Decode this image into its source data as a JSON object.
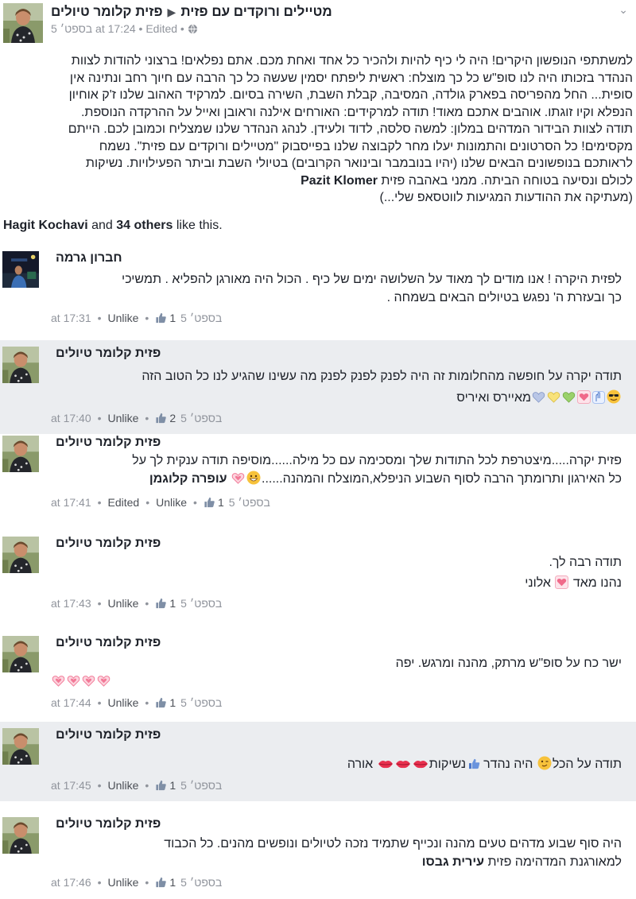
{
  "header": {
    "author": "פזית קלומר טיולים",
    "arrow": "▶",
    "group": "מטיילים ורוקדים עם פזית",
    "meta": "5 בספט׳ at 17:24 • Edited •"
  },
  "post": {
    "lines": [
      "למשתתפי הנופשון היקרים! היה לי כיף להיות ולהכיר כל אחד ואחת מכם. אתם נפלאים! ברצוני להודות לצוות",
      "הנהדר בזכותו היה לנו סופ\"ש כל כך מוצלח: ראשית ליפתח יסמין שעשה כל כך הרבה עם חיוך רחב ונתינה אין",
      "סופית... החל מהפריסה בפארק גולדה, המסיבה, קבלת השבת, השירה בסיום. למרקיד האהוב שלנו ז'ק אוחיון",
      "הנפלא וקיו זוגתו. אוהבים אתכם מאוד! תודה למרקידים: האורחים אילנה וראובן ואייל על ההרקדה הנוספת.",
      "תודה לצוות הבידור המדהים במלון: למשה סלסה, לדוד ולעידן. לנהג הנהדר שלנו שמצליח וכמובן לכם. הייתם",
      "מקסימים! כל הסרטונים והתמונות יעלו מחר לקבוצה שלנו בפייסבוק \"מטיילים ורוקדים עם פזית\". נשמח",
      "לראותכם בנופשונים הבאים שלנו (יהיו בנובמבר ובינואר הקרובים) בטיולי השבת וביתר הפעילויות. נשיקות"
    ],
    "line8_pre": "לכולם  ונסיעה בטוחה הביתה. ממני באהבה פזית ",
    "line8_name": "Pazit Klomer",
    "line9": "(מעתיקה את ההודעות המגיעות לווטסאפ שלי...)"
  },
  "likes": {
    "name": "Hagit Kochavi",
    "mid": " and ",
    "others": "34 others",
    "suffix": " like this."
  },
  "comments": [
    {
      "author": "חברון גרמה",
      "lines": [
        "לפזית היקרה ! אנו מודים לך מאוד על השלושה ימים של כיף . הכול היה מאורגן להפליא . תמשיכי",
        "כך ובעזרת ה' נפגש בטיולים הבאים בשמחה ."
      ],
      "time": "at 17:31",
      "unlike": "Unlike",
      "count": "1",
      "date": "5 בספט׳"
    },
    {
      "author": "פזית קלומר טיולים",
      "lines": [
        "תודה יקרה על חופשה מהחלומות זה היה לפנק לפנק לפנק מה עשינו שהגיע לנו כל הטוב הזה"
      ],
      "line2_text": "מאיירס ואיריס",
      "time": "at 17:40",
      "unlike": "Unlike",
      "count": "2",
      "date": "5 בספט׳"
    },
    {
      "author": "פזית קלומר טיולים",
      "lines": [
        "פזית יקרה.....מיצטרפת  לכל התודות שלך ומסכימה עם כל מילה......מוסיפה תודה ענקית לך על"
      ],
      "line2_text": "כל האירגון ותרומתך הרבה לסוף השבוע הניפלא,המוצלח והמהנה......",
      "line2_name": "עופרה קלוגמן",
      "time": "at 17:41",
      "edited": "Edited",
      "unlike": "Unlike",
      "count": "1",
      "date": "5 בספט׳"
    },
    {
      "author": "פזית קלומר טיולים",
      "line1": "תודה רבה לך.",
      "line2_pre": "נהנו מאד",
      "line2_post": "אלוני",
      "time": "at 17:43",
      "unlike": "Unlike",
      "count": "1",
      "date": "5 בספט׳"
    },
    {
      "author": "פזית קלומר טיולים",
      "line1": "ישר כח על סופ\"ש מרתק, מהנה ומרגש. יפה",
      "time": "at 17:44",
      "unlike": "Unlike",
      "count": "1",
      "date": "5 בספט׳"
    },
    {
      "author": "פזית קלומר טיולים",
      "t1": "תודה על הכל",
      "t2": "היה נהדר",
      "t3": "נשיקות",
      "t4": "אורה",
      "time": "at 17:45",
      "unlike": "Unlike",
      "count": "1",
      "date": "5 בספט׳"
    },
    {
      "author": "פזית קלומר טיולים",
      "lines": [
        "היה סוף שבוע מדהים טעים מהנה ונכייף שתמיד נזכה לטיולים ונופשים מהנים. כל הכבוד"
      ],
      "line2_pre": "למאורגנת המדהימה פזית ",
      "line2_name": "עירית גבסו",
      "time": "at 17:46",
      "unlike": "Unlike",
      "count": "1",
      "date": "5 בספט׳"
    }
  ],
  "icons": {
    "avatar": "profile-photo",
    "thumb": "like-thumb-icon",
    "globe": "globe-icon",
    "chevron": "chevron-down-icon"
  },
  "colors": {
    "link": "#365899",
    "meta": "#90949c",
    "gray_bg": "#ebedf0",
    "heart_pink": "#f06a8a"
  }
}
